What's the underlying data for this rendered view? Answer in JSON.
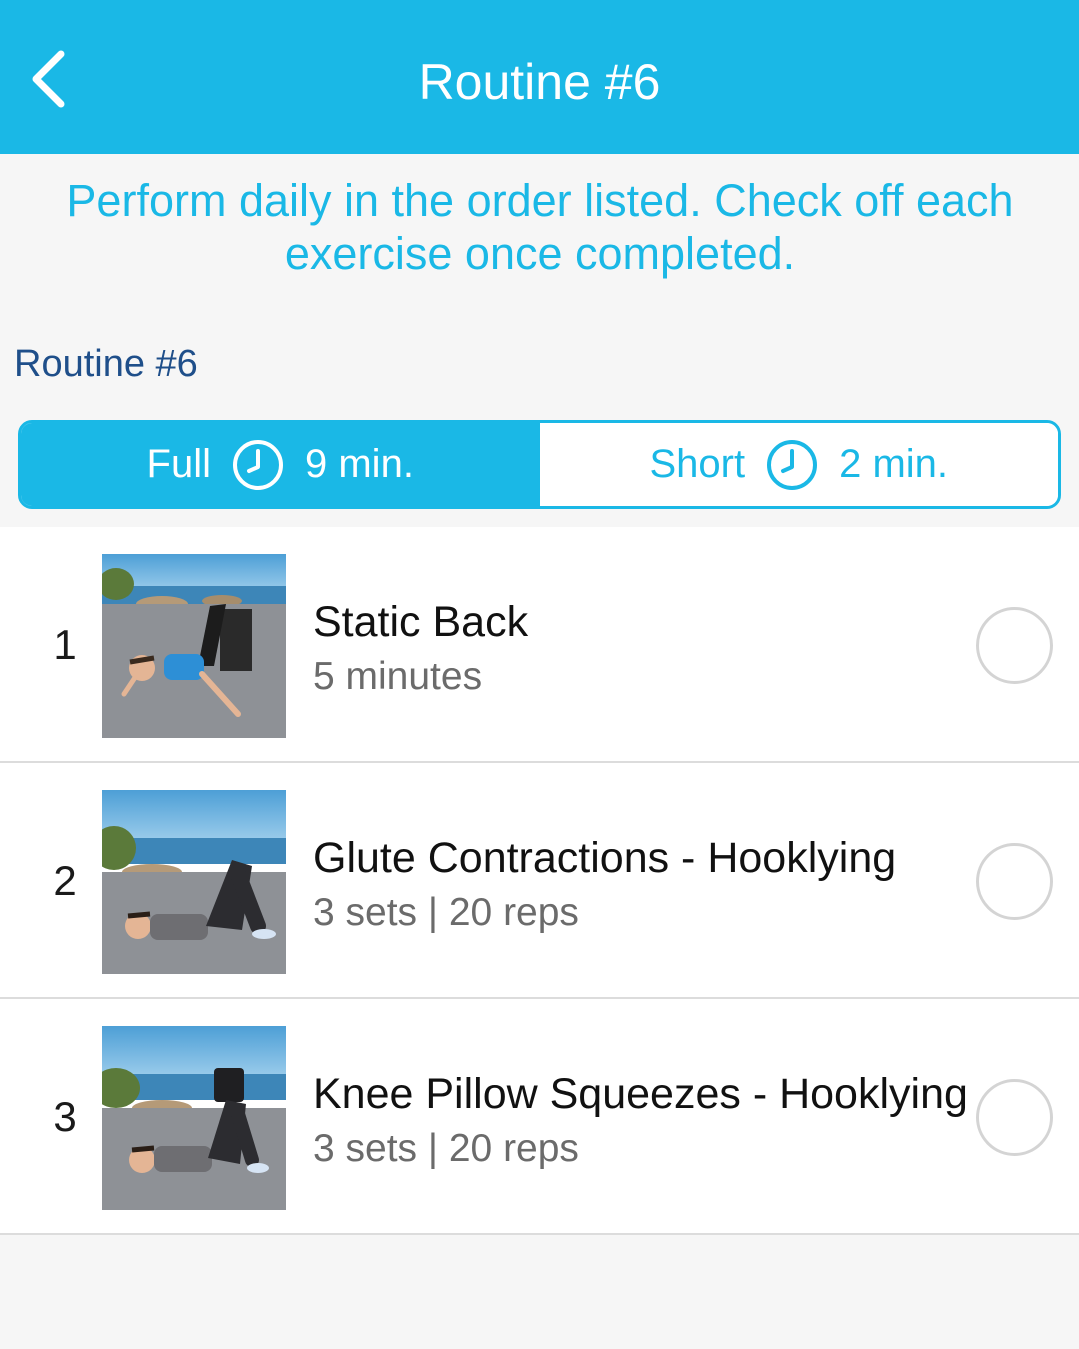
{
  "header": {
    "title": "Routine #6",
    "back_icon": "chevron-left-icon"
  },
  "instructions": "Perform daily in the order listed. Check off each exercise once completed.",
  "section_title": "Routine #6",
  "duration_toggle": {
    "options": [
      {
        "label": "Full",
        "duration": "9 min.",
        "icon": "clock-icon",
        "selected": true
      },
      {
        "label": "Short",
        "duration": "2 min.",
        "icon": "clock-icon",
        "selected": false
      }
    ]
  },
  "exercises": [
    {
      "number": "1",
      "name": "Static Back",
      "detail": "5 minutes",
      "completed": false
    },
    {
      "number": "2",
      "name": "Glute Contractions - Hooklying",
      "detail": "3 sets | 20 reps",
      "completed": false
    },
    {
      "number": "3",
      "name": "Knee Pillow Squeezes - Hooklying",
      "detail": "3 sets | 20 reps",
      "completed": false
    }
  ],
  "colors": {
    "accent": "#1ab8e6",
    "section_title": "#1f4f8a",
    "background": "#f6f6f6"
  }
}
